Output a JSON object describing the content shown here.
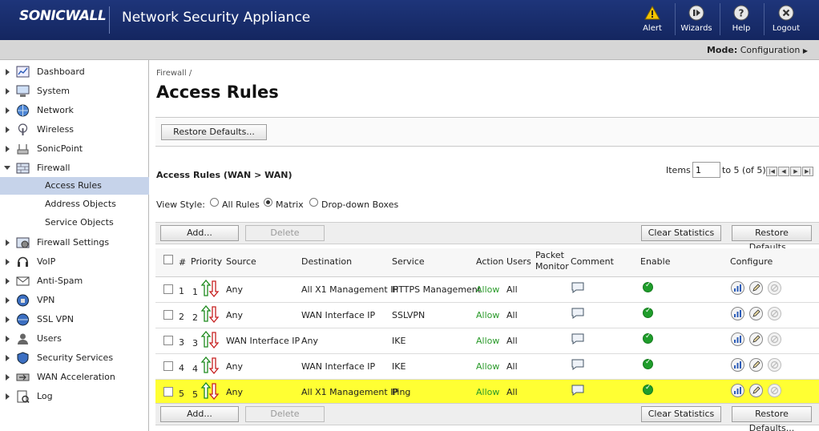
{
  "header": {
    "logo": "SONICWALL",
    "title": "Network Security Appliance",
    "buttons": [
      {
        "label": "Alert",
        "icon": "alert-icon"
      },
      {
        "label": "Wizards",
        "icon": "wizards-icon"
      },
      {
        "label": "Help",
        "icon": "help-icon"
      },
      {
        "label": "Logout",
        "icon": "logout-icon"
      }
    ]
  },
  "modebar": {
    "mode_label": "Mode:",
    "mode_value": "Configuration"
  },
  "sidebar": {
    "items": [
      {
        "label": "Dashboard",
        "icon": "dashboard-icon"
      },
      {
        "label": "System",
        "icon": "system-icon"
      },
      {
        "label": "Network",
        "icon": "network-icon"
      },
      {
        "label": "Wireless",
        "icon": "wireless-icon"
      },
      {
        "label": "SonicPoint",
        "icon": "sonicpoint-icon"
      },
      {
        "label": "Firewall",
        "icon": "firewall-icon"
      },
      {
        "label": "Firewall Settings",
        "icon": "firewall-settings-icon"
      },
      {
        "label": "VoIP",
        "icon": "voip-icon"
      },
      {
        "label": "Anti-Spam",
        "icon": "anti-spam-icon"
      },
      {
        "label": "VPN",
        "icon": "vpn-icon"
      },
      {
        "label": "SSL VPN",
        "icon": "ssl-vpn-icon"
      },
      {
        "label": "Users",
        "icon": "users-icon"
      },
      {
        "label": "Security Services",
        "icon": "security-services-icon"
      },
      {
        "label": "WAN Acceleration",
        "icon": "wan-acceleration-icon"
      },
      {
        "label": "Log",
        "icon": "log-icon"
      }
    ],
    "firewall_sub": [
      "Access Rules",
      "Address Objects",
      "Service Objects"
    ],
    "active_sub": "Access Rules"
  },
  "main": {
    "breadcrumb": "Firewall /",
    "title": "Access Rules",
    "restore_defaults_top": "Restore Defaults...",
    "section_title": "Access Rules (WAN > WAN)",
    "items_label": "Items",
    "items_value": "1",
    "items_of": "to 5 (of 5)",
    "view_style_label": "View Style:",
    "view_options": [
      "All Rules",
      "Matrix",
      "Drop-down Boxes"
    ],
    "view_selected": "Matrix",
    "toolbar": {
      "add": "Add...",
      "delete": "Delete",
      "clear_stats": "Clear Statistics",
      "restore": "Restore Defaults..."
    },
    "columns": {
      "num": "#",
      "priority": "Priority",
      "source": "Source",
      "destination": "Destination",
      "service": "Service",
      "action": "Action",
      "users": "Users",
      "packet_monitor_1": "Packet",
      "packet_monitor_2": "Monitor",
      "comment": "Comment",
      "enable": "Enable",
      "configure": "Configure"
    },
    "rows": [
      {
        "num": "1",
        "priority": "1",
        "source": "Any",
        "destination": "All X1 Management IP",
        "service": "HTTPS Management",
        "action": "Allow",
        "users": "All"
      },
      {
        "num": "2",
        "priority": "2",
        "source": "Any",
        "destination": "WAN Interface IP",
        "service": "SSLVPN",
        "action": "Allow",
        "users": "All"
      },
      {
        "num": "3",
        "priority": "3",
        "source": "WAN Interface IP",
        "destination": "Any",
        "service": "IKE",
        "action": "Allow",
        "users": "All"
      },
      {
        "num": "4",
        "priority": "4",
        "source": "Any",
        "destination": "WAN Interface IP",
        "service": "IKE",
        "action": "Allow",
        "users": "All"
      },
      {
        "num": "5",
        "priority": "5",
        "source": "Any",
        "destination": "All X1 Management IP",
        "service": "Ping",
        "action": "Allow",
        "users": "All"
      }
    ],
    "highlight_row": 5,
    "colors": {
      "header_bg": "#1a2e6e",
      "allow": "#2a9a2a",
      "highlight": "#ffff33",
      "active_nav": "#c6d3ea"
    }
  }
}
